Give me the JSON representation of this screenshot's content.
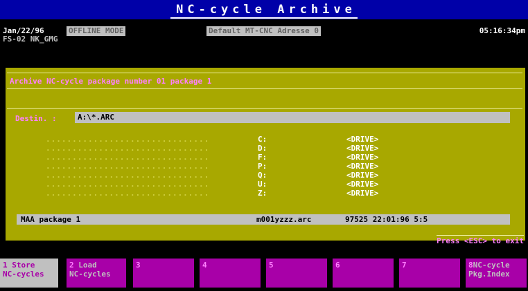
{
  "title": "NC-cycle Archive",
  "header": {
    "date": "Jan/22/96",
    "mode": "OFFLINE MODE",
    "address": "Default MT-CNC Adresse 0",
    "time": "05:16:34pm",
    "subline": "FS-02 NK_GMG"
  },
  "archive_line": "Archive NC-cycle package number 01 package 1",
  "destination": {
    "label": "Destin. :",
    "value": "A:\\*.ARC"
  },
  "drives": [
    {
      "letter": "C:",
      "type": "<DRIVE>"
    },
    {
      "letter": "D:",
      "type": "<DRIVE>"
    },
    {
      "letter": "F:",
      "type": "<DRIVE>"
    },
    {
      "letter": "P:",
      "type": "<DRIVE>"
    },
    {
      "letter": "Q:",
      "type": "<DRIVE>"
    },
    {
      "letter": "U:",
      "type": "<DRIVE>"
    },
    {
      "letter": "Z:",
      "type": "<DRIVE>"
    }
  ],
  "dots": "...............................",
  "selected": {
    "name": "MAA package 1",
    "file": "m001yzzz.arc",
    "info": "97525 22:01:96 5:5"
  },
  "press_hint": "Press <ESC> to exit",
  "fkeys": [
    {
      "num": "1",
      "line1": "Store",
      "line2": "NC-cycles"
    },
    {
      "num": "2",
      "line1": "Load",
      "line2": "NC-cycles"
    },
    {
      "num": "3",
      "line1": "",
      "line2": ""
    },
    {
      "num": "4",
      "line1": "",
      "line2": ""
    },
    {
      "num": "5",
      "line1": "",
      "line2": ""
    },
    {
      "num": "6",
      "line1": "",
      "line2": ""
    },
    {
      "num": "7",
      "line1": "",
      "line2": ""
    },
    {
      "num": "8",
      "line1": "NC-cycle",
      "line2": "Pkg.Index"
    }
  ]
}
